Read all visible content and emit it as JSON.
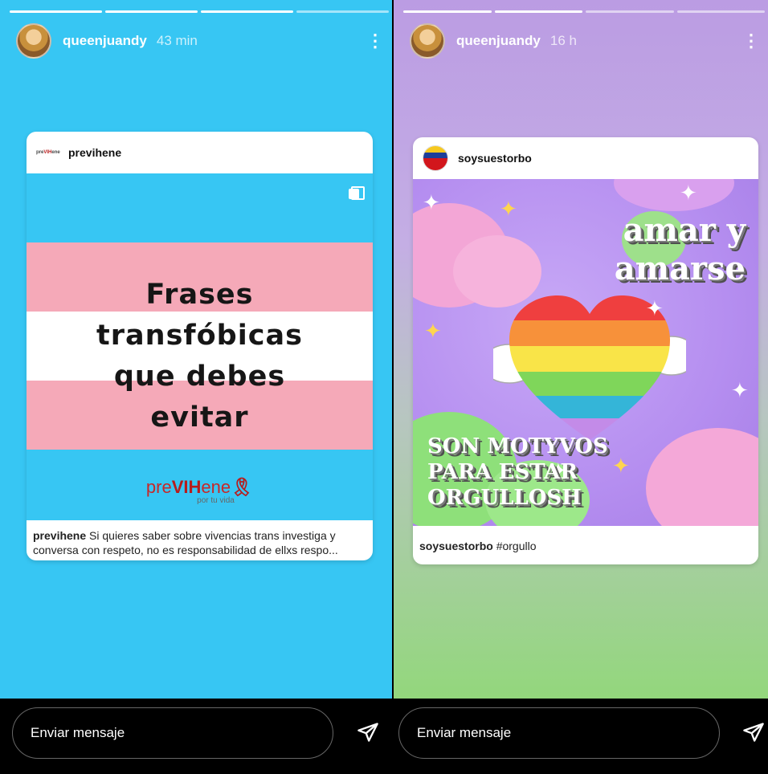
{
  "stories": [
    {
      "username": "queenjuandy",
      "time": "43 min",
      "post": {
        "account": "previhene",
        "headline_lines": [
          "Frases",
          "transfóbicas",
          "que debes",
          "evitar"
        ],
        "brand_pre": "pre",
        "brand_vih": "VIH",
        "brand_post": "ene",
        "brand_sub": "por tu vida",
        "caption_user": "previhene",
        "caption_text": " Si quieres saber sobre vivencias trans investiga y conversa con respeto, no es responsabilidad de ellxs respo..."
      },
      "message_placeholder": "Enviar mensaje"
    },
    {
      "username": "queenjuandy",
      "time": "16 h",
      "post": {
        "account": "soysuestorbo",
        "art_line1": "amar y",
        "art_line2": "amarse",
        "art_line3": "SON MOTYVOS",
        "art_line4": "PARA ESTAR",
        "art_line5": "ORGULLOSH",
        "caption_user": "soysuestorbo",
        "caption_text": " #orgullo"
      },
      "message_placeholder": "Enviar mensaje"
    }
  ],
  "colors": {
    "left_bg": "#37c6f3",
    "trans_pink": "#f5a9b8",
    "right_bg_top": "#bb9ce3",
    "right_bg_bottom": "#93d77c"
  },
  "icons": [
    "more-vertical-icon",
    "multiple-images-icon",
    "send-icon",
    "ribbon-icon"
  ]
}
